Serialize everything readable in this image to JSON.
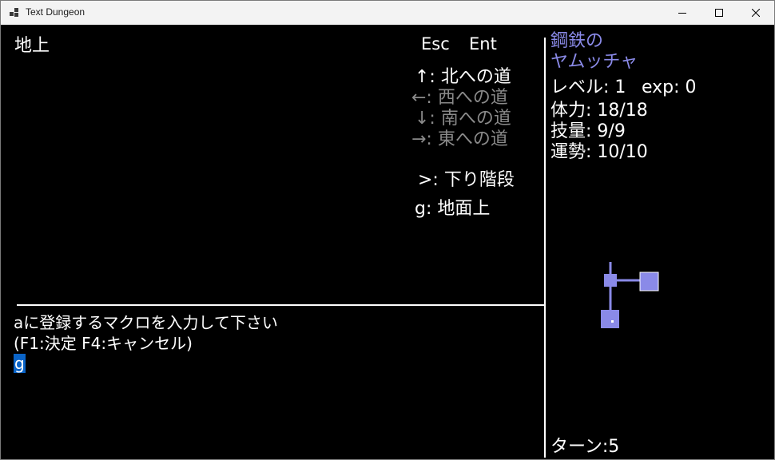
{
  "window": {
    "title": "Text Dungeon"
  },
  "location": "地上",
  "keys": {
    "esc": "Esc",
    "ent": "Ent"
  },
  "directions": [
    {
      "label": "↑: 北への道",
      "enabled": true
    },
    {
      "label": "←: 西への道",
      "enabled": false
    },
    {
      "label": "↓: 南への道",
      "enabled": false
    },
    {
      "label": "→: 東への道",
      "enabled": false
    }
  ],
  "actions": [
    {
      "label": ">: 下り階段"
    },
    {
      "label": "g: 地面上"
    }
  ],
  "character": {
    "title": "鋼鉄の",
    "name": "ヤムッチャ",
    "level": "レベル: 1",
    "exp": "exp: 0",
    "hp": "体力: 18/18",
    "skill": "技量: 9/9",
    "luck": "運勢: 10/10"
  },
  "message": {
    "line1": "aに登録するマクロを入力して下さい",
    "line2": "(F1:決定 F4:キャンセル)",
    "input_value": "g"
  },
  "turn": "ターン:5",
  "colors": {
    "accent": "#8a8ae8",
    "selection": "#0a64c8",
    "disabled": "#8a8a8a"
  }
}
